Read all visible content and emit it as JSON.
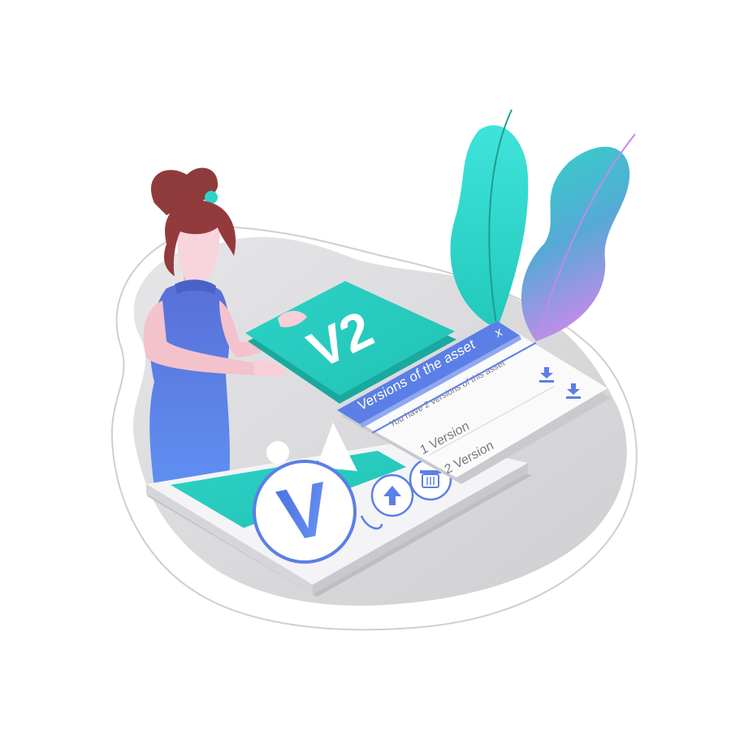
{
  "colors": {
    "primary_blue": "#5b7fe6",
    "teal": "#2fd3c8",
    "teal_dark": "#1fbfb3",
    "hair": "#8b3a3a",
    "skin": "#f4c6cf",
    "blob_gray": "#d9d9db"
  },
  "icons": {
    "v_badge": "letter-v-badge",
    "upload": "upload-arrow-icon",
    "delete": "trash-icon",
    "download": "download-icon",
    "close": "close-x-icon"
  },
  "v2_card": {
    "label": "V2"
  },
  "asset_card": {
    "badge_letter": "V"
  },
  "versions_dialog": {
    "title": "Versions of the asset",
    "close_label": "x",
    "subtitle": "You have 2 versions of this asset",
    "items": [
      {
        "label": "1 Version"
      },
      {
        "label": "2 Version"
      }
    ]
  }
}
